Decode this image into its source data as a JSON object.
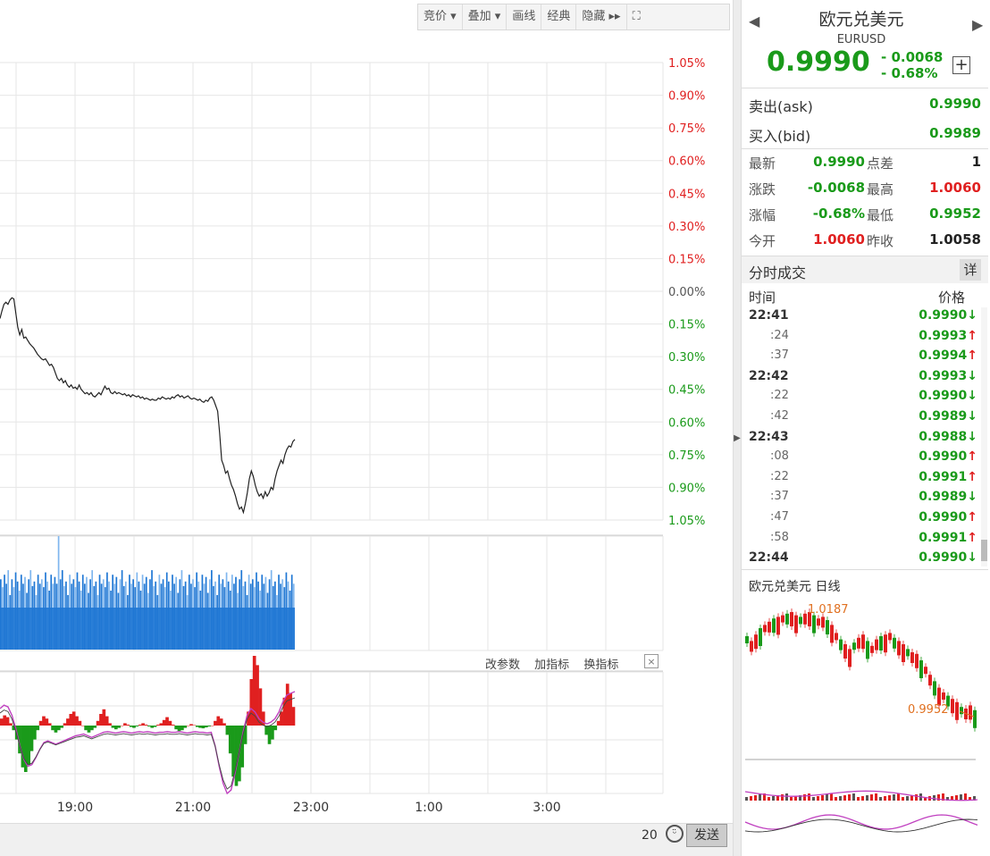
{
  "toolbar": {
    "items": [
      "竞价 ▾",
      "叠加 ▾",
      "画线",
      "经典",
      "隐藏 ▸▸",
      "⛶"
    ]
  },
  "quote": {
    "name": "欧元兑美元",
    "code": "EURUSD",
    "price": "0.9990",
    "change": "- 0.0068",
    "change_pct": "- 0.68%",
    "add_label": "+",
    "ask_label": "卖出(ask)",
    "ask": "0.9990",
    "bid_label": "买入(bid)",
    "bid": "0.9989",
    "stats": [
      {
        "l1": "最新",
        "v1": "0.9990",
        "c1": "green",
        "l2": "点差",
        "v2": "1",
        "c2": "black"
      },
      {
        "l1": "涨跌",
        "v1": "-0.0068",
        "c1": "green",
        "l2": "最高",
        "v2": "1.0060",
        "c2": "red"
      },
      {
        "l1": "涨幅",
        "v1": "-0.68%",
        "c1": "green",
        "l2": "最低",
        "v2": "0.9952",
        "c2": "green"
      },
      {
        "l1": "今开",
        "v1": "1.0060",
        "c1": "red",
        "l2": "昨收",
        "v2": "1.0058",
        "c2": "black"
      }
    ]
  },
  "ticks": {
    "title": "分时成交",
    "detail": "详",
    "col_time": "时间",
    "col_price": "价格",
    "rows": [
      {
        "time": "22:41",
        "sub": false,
        "price": "0.9990",
        "dir": "down"
      },
      {
        "time": ":24",
        "sub": true,
        "price": "0.9993",
        "dir": "up"
      },
      {
        "time": ":37",
        "sub": true,
        "price": "0.9994",
        "dir": "up"
      },
      {
        "time": "22:42",
        "sub": false,
        "price": "0.9993",
        "dir": "down"
      },
      {
        "time": ":22",
        "sub": true,
        "price": "0.9990",
        "dir": "down"
      },
      {
        "time": ":42",
        "sub": true,
        "price": "0.9989",
        "dir": "down"
      },
      {
        "time": "22:43",
        "sub": false,
        "price": "0.9988",
        "dir": "down"
      },
      {
        "time": ":08",
        "sub": true,
        "price": "0.9990",
        "dir": "up"
      },
      {
        "time": ":22",
        "sub": true,
        "price": "0.9991",
        "dir": "up"
      },
      {
        "time": ":37",
        "sub": true,
        "price": "0.9989",
        "dir": "down"
      },
      {
        "time": ":47",
        "sub": true,
        "price": "0.9990",
        "dir": "up"
      },
      {
        "time": ":58",
        "sub": true,
        "price": "0.9991",
        "dir": "up"
      },
      {
        "time": "22:44",
        "sub": false,
        "price": "0.9990",
        "dir": "down"
      }
    ]
  },
  "daily": {
    "title": "欧元兑美元 日线",
    "high_label": "1.0187",
    "low_label": "0.9952"
  },
  "indicator_links": [
    "改参数",
    "加指标",
    "换指标"
  ],
  "indicator_close": "×",
  "footer": {
    "count": "20",
    "send": "发送",
    "smile": "ᵕ̈"
  },
  "chart_data": {
    "type": "line",
    "y_pct_labels": [
      "1.05%",
      "0.90%",
      "0.75%",
      "0.60%",
      "0.45%",
      "0.30%",
      "0.15%",
      "0.00%",
      "0.15%",
      "0.30%",
      "0.45%",
      "0.60%",
      "0.75%",
      "0.90%",
      "1.05%"
    ],
    "x_labels": [
      "19:00",
      "21:00",
      "23:00",
      "1:00",
      "3:00"
    ],
    "ylim_pct": [
      -1.05,
      1.05
    ],
    "grid": true,
    "colors": {
      "up": "#e02020",
      "down": "#1a9a1a",
      "zero": "#555555",
      "line": "#222222",
      "volume": "#1f77d4",
      "volume_light": "#7fb6ee",
      "macd_line": "#c040c0"
    },
    "price_pct_series": [
      -0.25,
      -0.18,
      -0.12,
      -0.1,
      -0.12,
      -0.08,
      -0.06,
      -0.07,
      -0.2,
      -0.33,
      -0.4,
      -0.35,
      -0.43,
      -0.42,
      -0.45,
      -0.48,
      -0.5,
      -0.52,
      -0.55,
      -0.58,
      -0.6,
      -0.62,
      -0.63,
      -0.62,
      -0.65,
      -0.68,
      -0.67,
      -0.7,
      -0.75,
      -0.8,
      -0.82,
      -0.8,
      -0.84,
      -0.82,
      -0.86,
      -0.88,
      -0.86,
      -0.89,
      -0.88,
      -0.9,
      -0.86,
      -0.9,
      -0.92,
      -0.94,
      -0.93,
      -0.95,
      -0.93,
      -0.96,
      -0.97,
      -0.95,
      -0.93,
      -0.95,
      -0.91,
      -0.87,
      -0.9,
      -0.89,
      -0.93,
      -0.94,
      -0.92,
      -0.94,
      -0.93,
      -0.94,
      -0.95,
      -0.94,
      -0.96,
      -0.95,
      -0.97,
      -0.95,
      -0.96,
      -0.97,
      -0.96,
      -0.98,
      -0.97,
      -0.99,
      -0.98,
      -0.99,
      -1.0,
      -0.99,
      -1.0,
      -1.0,
      -0.98,
      -0.99,
      -0.97,
      -0.98,
      -0.99,
      -0.98,
      -0.99,
      -0.97,
      -0.98,
      -0.96,
      -0.95,
      -0.97,
      -0.96,
      -0.98,
      -0.97,
      -0.96,
      -0.98,
      -0.99,
      -0.98,
      -0.99,
      -1.0,
      -0.99,
      -1.01,
      -1.02,
      -1.0,
      -1.01,
      -0.98,
      -0.97,
      -1.0,
      -1.05,
      -1.1,
      -1.3,
      -1.55,
      -1.6,
      -1.67,
      -1.65,
      -1.72,
      -1.78,
      -1.82,
      -1.88,
      -1.95,
      -2.0,
      -1.98,
      -2.03,
      -1.95,
      -1.85,
      -1.72,
      -1.65,
      -1.7,
      -1.78,
      -1.84,
      -1.88,
      -1.86,
      -1.9,
      -1.84,
      -1.88,
      -1.85,
      -1.8,
      -1.82,
      -1.72,
      -1.65,
      -1.6,
      -1.55,
      -1.58,
      -1.5,
      -1.45,
      -1.42,
      -1.43,
      -1.38,
      -1.36
    ],
    "volume_series": [
      0.62,
      0.55,
      0.66,
      0.58,
      0.7,
      0.48,
      0.62,
      0.55,
      0.68,
      0.6,
      0.52,
      0.66,
      0.58,
      0.64,
      0.5,
      0.62,
      0.7,
      0.56,
      0.6,
      0.48,
      0.66,
      0.58,
      0.62,
      0.55,
      0.68,
      0.6,
      0.52,
      0.66,
      0.58,
      0.64,
      0.58,
      1.0,
      0.62,
      0.7,
      0.56,
      0.6,
      0.48,
      0.66,
      0.58,
      0.62,
      0.55,
      0.68,
      0.6,
      0.52,
      0.66,
      0.58,
      0.64,
      0.5,
      0.62,
      0.7,
      0.56,
      0.6,
      0.48,
      0.66,
      0.58,
      0.62,
      0.55,
      0.68,
      0.6,
      0.52,
      0.66,
      0.58,
      0.64,
      0.5,
      0.62,
      0.7,
      0.56,
      0.6,
      0.48,
      0.66,
      0.58,
      0.62,
      0.55,
      0.68,
      0.6,
      0.52,
      0.66,
      0.58,
      0.64,
      0.5,
      0.62,
      0.7,
      0.56,
      0.6,
      0.48,
      0.66,
      0.58,
      0.62,
      0.55,
      0.68,
      0.6,
      0.52,
      0.66,
      0.58,
      0.64,
      0.5,
      0.62,
      0.7,
      0.56,
      0.6,
      0.48,
      0.66,
      0.58,
      0.62,
      0.55,
      0.68,
      0.6,
      0.52,
      0.66,
      0.58,
      0.64,
      0.5,
      0.62,
      0.7,
      0.56,
      0.6,
      0.48,
      0.66,
      0.58,
      0.62,
      0.55,
      0.68,
      0.6,
      0.52,
      0.66,
      0.58,
      0.64,
      0.5,
      0.62,
      0.7,
      0.56,
      0.6,
      0.48,
      0.66,
      0.58,
      0.62,
      0.55,
      0.68,
      0.6,
      0.52,
      0.66,
      0.58,
      0.64,
      0.5,
      0.62,
      0.7,
      0.56,
      0.6,
      0.48,
      0.66,
      0.58,
      0.62,
      0.55,
      0.68,
      0.6,
      0.52,
      0.66,
      0.58
    ],
    "macd_hist": [
      0.15,
      0.22,
      0.18,
      0.05,
      -0.1,
      -0.3,
      -0.6,
      -0.9,
      -1.0,
      -0.85,
      -0.55,
      -0.3,
      -0.1,
      0.1,
      0.2,
      0.15,
      0.05,
      -0.1,
      -0.15,
      -0.1,
      -0.05,
      0.05,
      0.15,
      0.25,
      0.3,
      0.2,
      0.1,
      0.0,
      -0.1,
      -0.15,
      -0.1,
      -0.05,
      0.1,
      0.25,
      0.35,
      0.2,
      0.05,
      -0.05,
      -0.08,
      -0.05,
      0.0,
      0.05,
      0.02,
      -0.03,
      -0.05,
      -0.02,
      0.02,
      0.05,
      0.02,
      -0.02,
      -0.05,
      -0.03,
      0.02,
      0.05,
      0.12,
      0.18,
      0.1,
      0.02,
      -0.08,
      -0.12,
      -0.1,
      -0.05,
      0.0,
      0.03,
      0.01,
      -0.03,
      -0.05,
      -0.06,
      -0.04,
      -0.02,
      0.0,
      0.1,
      0.2,
      0.15,
      0.05,
      -0.2,
      -0.6,
      -1.1,
      -1.3,
      -1.2,
      -0.9,
      -0.4,
      0.3,
      1.0,
      1.5,
      1.3,
      0.8,
      0.3,
      -0.2,
      -0.4,
      -0.3,
      -0.1,
      0.1,
      0.3,
      0.6,
      0.9,
      0.7,
      0.4
    ],
    "macd_line": [
      0.5,
      0.6,
      0.55,
      0.3,
      -0.1,
      -0.6,
      -1.0,
      -1.2,
      -1.15,
      -0.95,
      -0.7,
      -0.5,
      -0.45,
      -0.5,
      -0.55,
      -0.5,
      -0.45,
      -0.4,
      -0.35,
      -0.3,
      -0.28,
      -0.25,
      -0.3,
      -0.35,
      -0.3,
      -0.25,
      -0.2,
      -0.18,
      -0.2,
      -0.22,
      -0.2,
      -0.18,
      -0.2,
      -0.22,
      -0.2,
      -0.18,
      -0.2,
      -0.18,
      -0.2,
      -0.22,
      -0.2,
      -0.2,
      -0.18,
      -0.2,
      -0.2,
      -0.18,
      -0.2,
      -0.22,
      -0.2,
      -0.18,
      -0.2,
      -0.2,
      -0.22,
      -0.2,
      -0.6,
      -1.2,
      -1.7,
      -2.0,
      -1.9,
      -1.4,
      -0.8,
      -0.2,
      0.3,
      0.5,
      0.4,
      0.2,
      0.1,
      0.05,
      0.1,
      0.2,
      0.4,
      0.7,
      0.9,
      0.95,
      1.0
    ]
  }
}
